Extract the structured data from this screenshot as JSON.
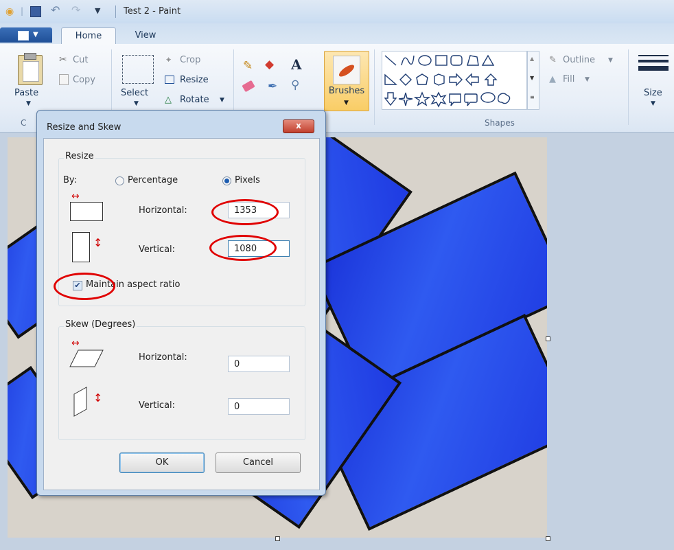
{
  "window": {
    "title": "Test 2 - Paint"
  },
  "tabs": [
    {
      "label": "Home"
    },
    {
      "label": "View"
    }
  ],
  "ribbon": {
    "clipboard": {
      "paste": "Paste",
      "cut": "Cut",
      "copy": "Copy",
      "group_initial": "C"
    },
    "image": {
      "select": "Select",
      "crop": "Crop",
      "resize": "Resize",
      "rotate": "Rotate"
    },
    "brushes": "Brushes",
    "shapes": {
      "outline": "Outline",
      "fill": "Fill",
      "group": "Shapes"
    },
    "size": "Size"
  },
  "dialog": {
    "title": "Resize and Skew",
    "close": "x",
    "resize": {
      "legend": "Resize",
      "by_label": "By:",
      "percentage": "Percentage",
      "pixels": "Pixels",
      "selected": "Pixels",
      "horizontal_label": "Horizontal:",
      "horizontal_value": "1353",
      "vertical_label": "Vertical:",
      "vertical_value": "1080",
      "maintain_label": "Maintain aspect ratio",
      "maintain_checked": true
    },
    "skew": {
      "legend": "Skew (Degrees)",
      "horizontal_label": "Horizontal:",
      "horizontal_value": "0",
      "vertical_label": "Vertical:",
      "vertical_value": "0"
    },
    "ok": "OK",
    "cancel": "Cancel"
  },
  "colors": {
    "highlight_ring": "#e00000",
    "accent": "#1f4f97"
  }
}
